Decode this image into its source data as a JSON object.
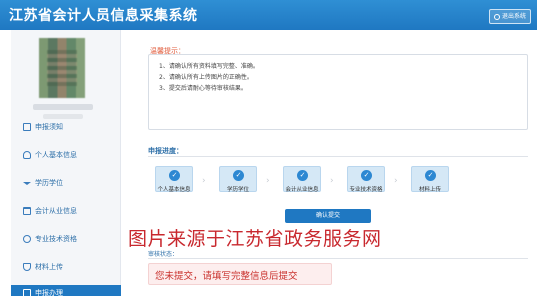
{
  "header": {
    "title": "江苏省会计人员信息采集系统",
    "exit_label": "退出系统"
  },
  "sidebar": {
    "items": [
      {
        "label": "申报须知",
        "icon": "document-icon"
      },
      {
        "label": "个人基本信息",
        "icon": "user-icon"
      },
      {
        "label": "学历学位",
        "icon": "graduation-cap-icon"
      },
      {
        "label": "会计从业信息",
        "icon": "briefcase-icon"
      },
      {
        "label": "专业技术资格",
        "icon": "info-icon"
      },
      {
        "label": "材料上传",
        "icon": "upload-icon"
      },
      {
        "label": "申报办理",
        "icon": "submit-icon",
        "active": true
      }
    ]
  },
  "notice": {
    "title": "温馨提示：",
    "lines": [
      "1、请确认所有资料填写完整、准确。",
      "2、请确认所有上传图片的正确性。",
      "3、提交后请耐心等待审核结果。"
    ]
  },
  "progress": {
    "title": "申报进度：",
    "steps": [
      {
        "label": "个人基本信息",
        "done": true
      },
      {
        "label": "学历学位",
        "done": true
      },
      {
        "label": "会计从业信息",
        "done": true
      },
      {
        "label": "专业技术资格",
        "done": true
      },
      {
        "label": "材料上传",
        "done": true
      }
    ]
  },
  "confirm_button": "确认提交",
  "watermark": "图片来源于江苏省政务服务网",
  "review": {
    "title": "审核状态：",
    "status": "您未提交，请填写完整信息后提交"
  },
  "colors": {
    "header": "#1f78c2",
    "accent": "#2d88d2",
    "status_text": "#c9302c",
    "watermark": "#c8282e"
  }
}
